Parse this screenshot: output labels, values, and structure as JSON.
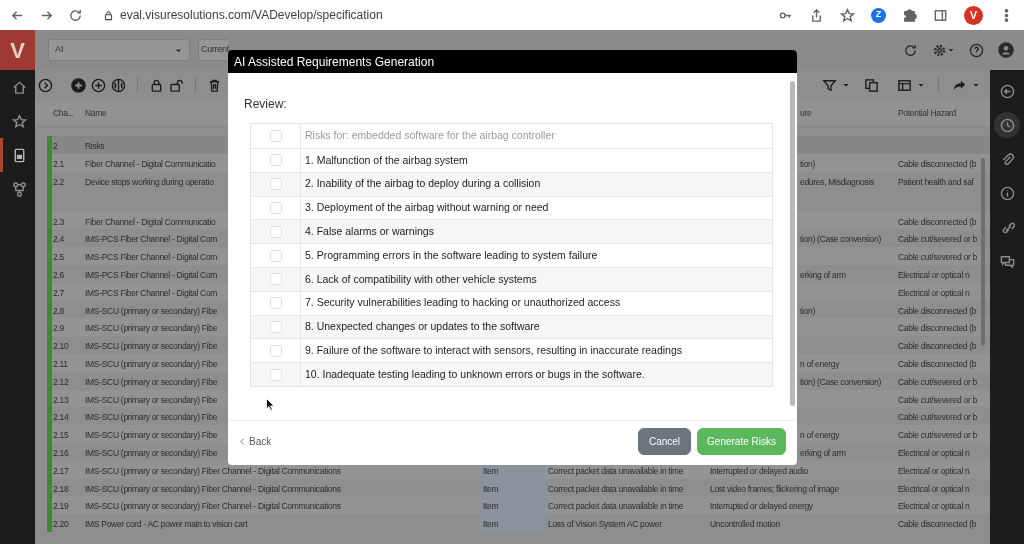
{
  "browser": {
    "url": "eval.visuresolutions.com/VADevelop/specification",
    "extension_letter": "Z",
    "profile_letter": "V"
  },
  "app": {
    "logo": "V",
    "selectors": [
      {
        "value": "AI"
      },
      {
        "value": "Current"
      }
    ]
  },
  "left_nav": [
    {
      "kind": "home",
      "selected": false
    },
    {
      "kind": "star",
      "selected": false
    },
    {
      "kind": "document",
      "selected": true
    },
    {
      "kind": "network",
      "selected": false
    }
  ],
  "right_nav": [
    {
      "kind": "back",
      "selected": false
    },
    {
      "kind": "history",
      "selected": true
    },
    {
      "kind": "attachment",
      "selected": false
    },
    {
      "kind": "info",
      "selected": false
    },
    {
      "kind": "link",
      "selected": false
    },
    {
      "kind": "comments",
      "selected": false
    }
  ],
  "table": {
    "columns": [
      {
        "label": "Cha..."
      },
      {
        "label": "Name"
      },
      {
        "label": "ure"
      },
      {
        "label": "Potential Hazard"
      }
    ],
    "rows": [
      {
        "kind": "group",
        "number": "2",
        "name": "Risks"
      },
      {
        "kind": "covered",
        "number": "2.1",
        "name": "Fiber Channel - Digital Communicatio",
        "effect": "tion)",
        "hazard": "Cable disconnected (b"
      },
      {
        "kind": "tall",
        "number": "2.2",
        "name": "Device stops working during operatio",
        "effect": "edures, Misdiagnosis",
        "hazard": "Patient health and saf"
      },
      {
        "kind": "covered",
        "number": "2.3",
        "name": "Fiber Channel - Digital Communicatio",
        "hazard": "Cable disconnected (b"
      },
      {
        "kind": "covered",
        "number": "2.4",
        "name": "IMS-PCS Fiber Channel - Digital Com",
        "effect": "tion) (Case conversion)",
        "hazard": "Cable cut/severed or b"
      },
      {
        "kind": "covered",
        "number": "2.5",
        "name": "IMS-PCS Fiber Channel - Digital Com",
        "hazard": "Cable cut/severed or b"
      },
      {
        "kind": "covered",
        "number": "2.6",
        "name": "IMS-PCS Fiber Channel - Digital Com",
        "effect": "erking of arm",
        "hazard": "Electrical or optical n"
      },
      {
        "kind": "covered",
        "number": "2.7",
        "name": "IMS-PCS Fiber Channel - Digital Com",
        "hazard": "Electrical or optical n"
      },
      {
        "kind": "covered",
        "number": "2.8",
        "name": "IMS-SCU (primary or secondary) Fibe",
        "effect": "tion)",
        "hazard": "Cable disconnected (b"
      },
      {
        "kind": "covered",
        "number": "2.9",
        "name": "IMS-SCU (primary or secondary) Fibe",
        "hazard": "Cable disconnected (b"
      },
      {
        "kind": "covered",
        "number": "2.10",
        "name": "IMS-SCU (primary or secondary) Fibe",
        "hazard": "Cable disconnected (b"
      },
      {
        "kind": "covered",
        "number": "2.11",
        "name": "IMS-SCU (primary or secondary) Fibe",
        "effect": "n of energy",
        "hazard": "Cable disconnected (b"
      },
      {
        "kind": "covered",
        "number": "2.12",
        "name": "IMS-SCU (primary or secondary) Fibe",
        "effect": "tion) (Case conversion)",
        "hazard": "Cable cut/severed or b"
      },
      {
        "kind": "covered",
        "number": "2.13",
        "name": "IMS-SCU (primary or secondary) Fibe",
        "hazard": "Cable cut/severed or b"
      },
      {
        "kind": "covered",
        "number": "2.14",
        "name": "IMS-SCU (primary or secondary) Fibe",
        "hazard": "Cable cut/severed or b"
      },
      {
        "kind": "covered",
        "number": "2.15",
        "name": "IMS-SCU (primary or secondary) Fibe",
        "effect": "n of energy",
        "hazard": "Cable cut/severed or b"
      },
      {
        "kind": "covered",
        "number": "2.16",
        "name": "IMS-SCU (primary or secondary) Fibe",
        "effect": "erking of arm",
        "hazard": "Electrical or optical n"
      },
      {
        "kind": "full",
        "number": "2.17",
        "name": "IMS-SCU (primary or secondary) Fiber Channel - Digital Communications",
        "type": "Item",
        "description": "Correct packet data unavailable in time",
        "effect": "Interrupted or delayed audio",
        "hazard": "Electrical or optical n"
      },
      {
        "kind": "full",
        "number": "2.18",
        "name": "IMS-SCU (primary or secondary) Fiber Channel - Digital Communications",
        "type": "Item",
        "description": "Correct packet data unavailable in time",
        "effect": "Lost video frames; flickering of image",
        "hazard": "Electrical or optical n"
      },
      {
        "kind": "full",
        "number": "2.19",
        "name": "IMS-SCU (primary or secondary) Fiber Channel - Digital Communications",
        "type": "Item",
        "description": "Correct packet data unavailable in time",
        "effect": "Interrupted or delayed energy",
        "hazard": "Electrical or optical n"
      },
      {
        "kind": "full",
        "number": "2.20",
        "name": "IMS Power cord - AC power main to vision cart",
        "type": "Item",
        "description": "Loss of Vision System AC power",
        "effect": "Uncontrolled motion",
        "hazard": "Cable disconnected (b"
      }
    ]
  },
  "modal": {
    "title": "AI Assisted Requirements Generation",
    "review_label": "Review:",
    "header": {
      "text": "Risks for: embedded software for the airbag controller",
      "checked": false
    },
    "items": [
      {
        "text": "1. Malfunction of the airbag system",
        "checked": false
      },
      {
        "text": "2. Inability of the airbag to deploy during a collision",
        "checked": false
      },
      {
        "text": "3. Deployment of the airbag without warning or need",
        "checked": false
      },
      {
        "text": "4. False alarms or warnings",
        "checked": false
      },
      {
        "text": "5. Programming errors in the software leading to system failure",
        "checked": false
      },
      {
        "text": "6. Lack of compatibility with other vehicle systems",
        "checked": false
      },
      {
        "text": "7. Security vulnerabilities leading to hacking or unauthorized access",
        "checked": false
      },
      {
        "text": "8. Unexpected changes or updates to the software",
        "checked": false
      },
      {
        "text": "9. Failure of the software to interact with sensors, resulting in inaccurate readings",
        "checked": false
      },
      {
        "text": "10. Inadequate testing leading to unknown errors or bugs in the software.",
        "checked": false
      }
    ],
    "back": "Back",
    "cancel": "Cancel",
    "generate": "Generate Risks"
  }
}
